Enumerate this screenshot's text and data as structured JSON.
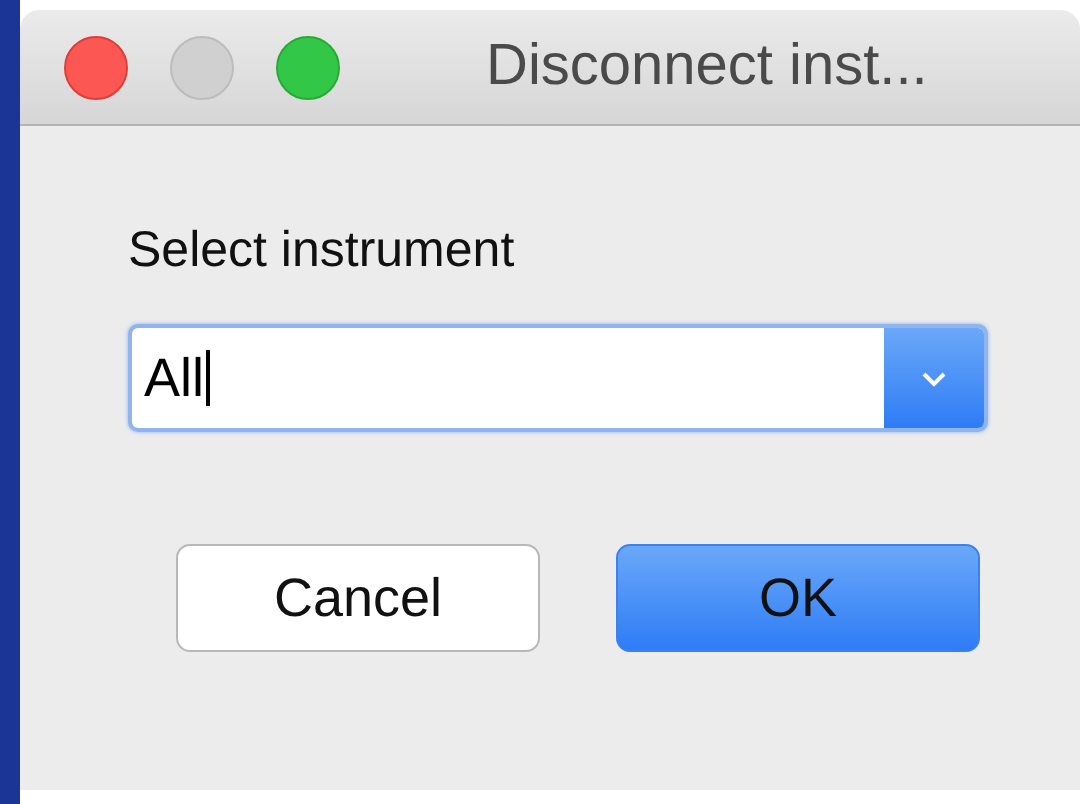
{
  "window": {
    "title": "Disconnect inst..."
  },
  "label": "Select instrument",
  "combo": {
    "value": "All",
    "focused": true
  },
  "buttons": [
    {
      "label": "Cancel",
      "default": false
    },
    {
      "label": "OK",
      "default": true
    }
  ]
}
